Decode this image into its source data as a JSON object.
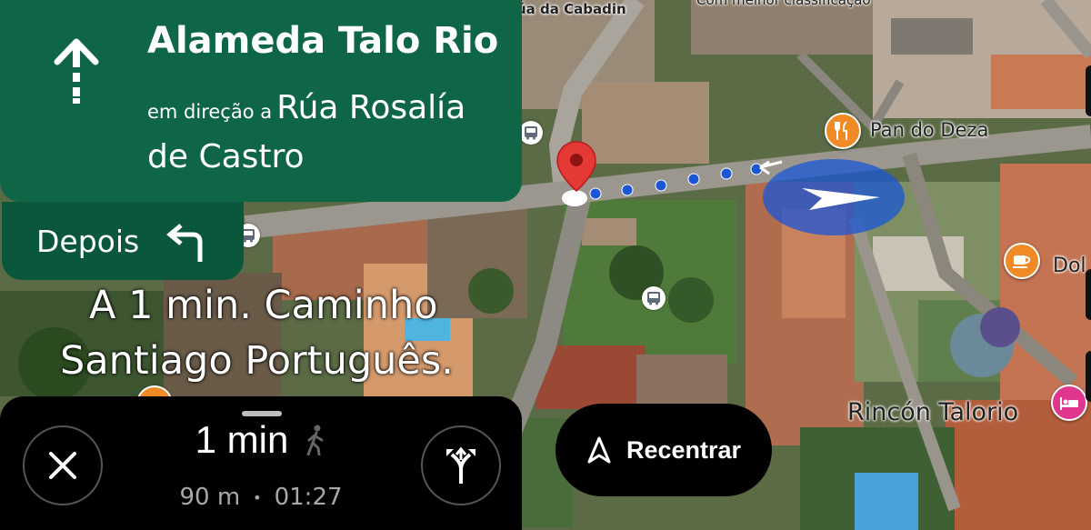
{
  "nav": {
    "street": "Alameda Talo Rio",
    "toward_prefix": "em direção a",
    "toward_line1": "Rúa Rosalía",
    "toward_line2": "de Castro",
    "maneuver_icon": "straight-arrow-icon"
  },
  "then": {
    "label": "Depois",
    "icon": "turn-left-icon"
  },
  "map": {
    "labels": {
      "top_street_partial": "úa da Cabadin",
      "top_partial": "Com melhor classificação",
      "pan_do_deza": "Pan do Deza",
      "dol_partial": "Dol",
      "rincon": "Rincón Talorio"
    },
    "overlay_line1": "A 1 min. Caminho",
    "overlay_line2": "Santiago Português.",
    "colors": {
      "route_blue": "#1a56d6",
      "poi_orange": "#f08a24",
      "poi_pink": "#e0368e",
      "pin_red": "#e53935"
    }
  },
  "trip": {
    "duration": "1 min",
    "distance": "90 m",
    "separator": "•",
    "arrival": "01:27",
    "mode_icon": "walking-icon",
    "close_icon": "close-icon",
    "alternatives_icon": "fork-routes-icon"
  },
  "recenter": {
    "label": "Recentrar",
    "icon": "navigation-arrow-icon"
  }
}
